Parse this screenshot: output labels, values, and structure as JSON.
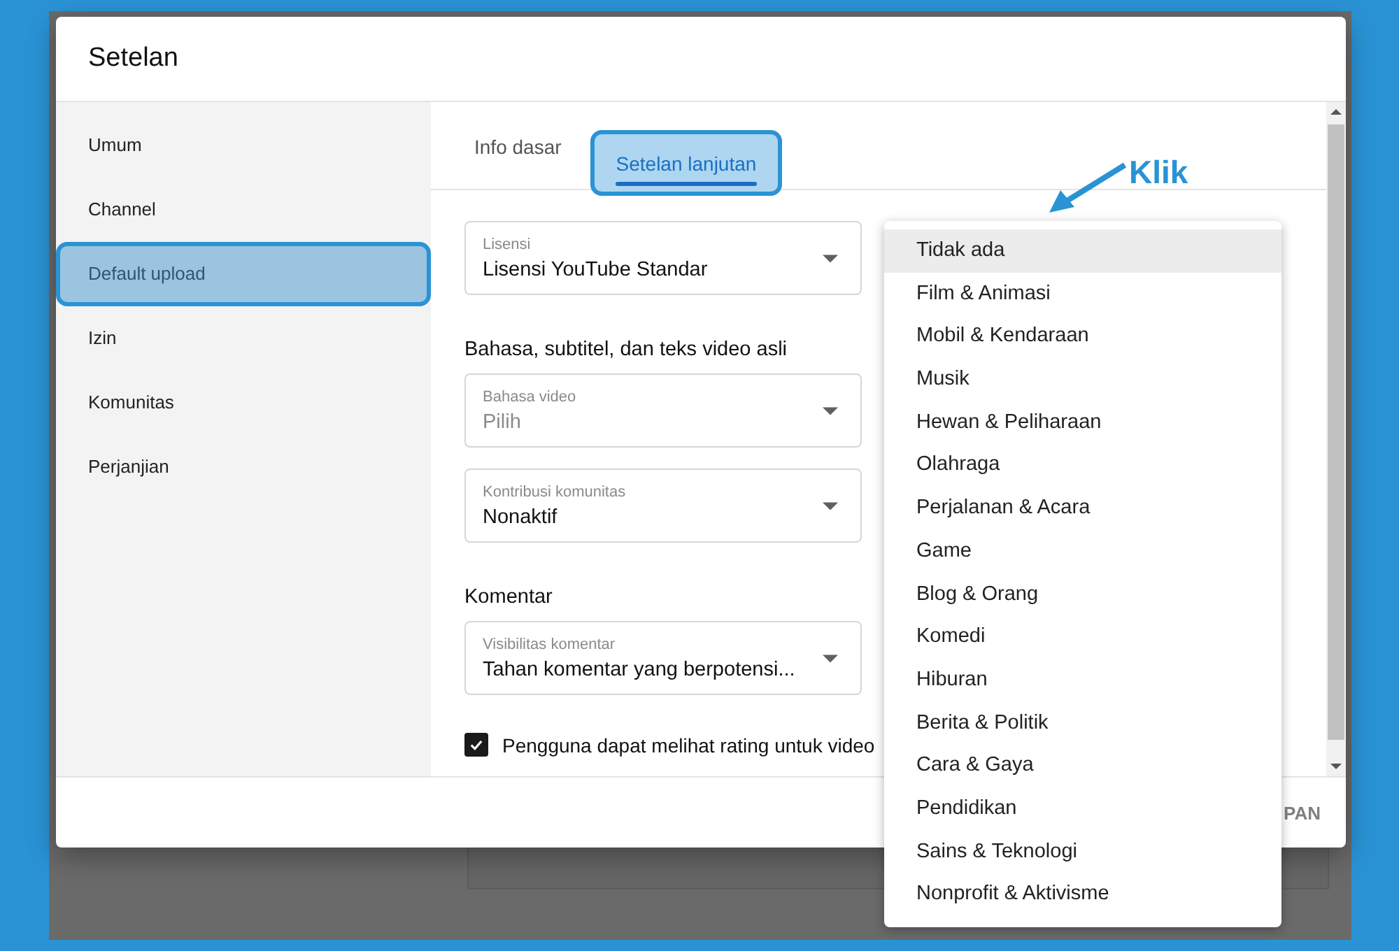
{
  "dialog": {
    "title": "Setelan"
  },
  "sidebar": {
    "items": [
      {
        "label": "Umum",
        "selected": false
      },
      {
        "label": "Channel",
        "selected": false
      },
      {
        "label": "Default upload",
        "selected": true
      },
      {
        "label": "Izin",
        "selected": false
      },
      {
        "label": "Komunitas",
        "selected": false
      },
      {
        "label": "Perjanjian",
        "selected": false
      }
    ]
  },
  "tabs": [
    {
      "label": "Info dasar",
      "selected": false
    },
    {
      "label": "Setelan lanjutan",
      "selected": true
    }
  ],
  "form": [
    {
      "kind": "select",
      "label": "Lisensi",
      "value": "Lisensi YouTube Standar"
    },
    {
      "kind": "heading",
      "text": "Bahasa, subtitel, dan teks video asli"
    },
    {
      "kind": "select",
      "label": "Bahasa video",
      "placeholder": "Pilih"
    },
    {
      "kind": "select",
      "label": "Kontribusi komunitas",
      "value": "Nonaktif"
    },
    {
      "kind": "heading",
      "text": "Komentar"
    },
    {
      "kind": "select",
      "label": "Visibilitas komentar",
      "value": "Tahan komentar yang berpotensi..."
    },
    {
      "kind": "checkbox",
      "label": "Pengguna dapat melihat rating untuk video",
      "checked": true
    }
  ],
  "footer": {
    "buttons": [
      "PAN"
    ]
  },
  "dropdown": {
    "options": [
      {
        "label": "Tidak ada",
        "selected": true
      },
      {
        "label": "Film & Animasi",
        "selected": false
      },
      {
        "label": "Mobil & Kendaraan",
        "selected": false
      },
      {
        "label": "Musik",
        "selected": false
      },
      {
        "label": "Hewan & Peliharaan",
        "selected": false
      },
      {
        "label": "Olahraga",
        "selected": false
      },
      {
        "label": "Perjalanan & Acara",
        "selected": false
      },
      {
        "label": "Game",
        "selected": false
      },
      {
        "label": "Blog & Orang",
        "selected": false
      },
      {
        "label": "Komedi",
        "selected": false
      },
      {
        "label": "Hiburan",
        "selected": false
      },
      {
        "label": "Berita & Politik",
        "selected": false
      },
      {
        "label": "Cara & Gaya",
        "selected": false
      },
      {
        "label": "Pendidikan",
        "selected": false
      },
      {
        "label": "Sains & Teknologi",
        "selected": false
      },
      {
        "label": "Nonprofit & Aktivisme",
        "selected": false
      }
    ]
  },
  "annotation": {
    "text": "Klik"
  }
}
